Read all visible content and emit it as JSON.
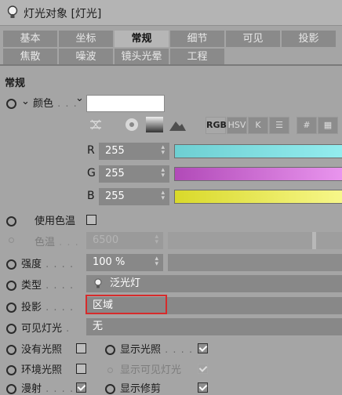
{
  "window": {
    "title": "灯光对象 [灯光]"
  },
  "tabs_row1": [
    "基本",
    "坐标",
    "常规",
    "细节",
    "可见",
    "投影"
  ],
  "tabs_row2": [
    "焦散",
    "噪波",
    "镜头光晕",
    "工程"
  ],
  "selected_tab": "常规",
  "section_title": "常规",
  "color": {
    "label": "颜色",
    "swatch": "#ffffff",
    "modes": [
      "RGB",
      "HSV",
      "K",
      "#"
    ],
    "r": {
      "label": "R",
      "value": "255"
    },
    "g": {
      "label": "G",
      "value": "255"
    },
    "b": {
      "label": "B",
      "value": "255"
    }
  },
  "use_temperature": {
    "label": "使用色温",
    "checked": false
  },
  "temperature": {
    "label": "色温",
    "value": "6500"
  },
  "intensity": {
    "label": "强度",
    "value": "100 %"
  },
  "type": {
    "label": "类型",
    "value": "泛光灯"
  },
  "shadow": {
    "label": "投影",
    "value": "区域",
    "highlight": "#d62b2b"
  },
  "visible_light": {
    "label": "可见灯光",
    "value": "无"
  },
  "no_illumination": {
    "label": "没有光照",
    "checked": false
  },
  "show_illumination": {
    "label": "显示光照",
    "checked": true
  },
  "ambient_illumination": {
    "label": "环境光照",
    "checked": false
  },
  "show_visible_light": {
    "label": "显示可见灯光",
    "checked": true
  },
  "diffuse": {
    "label": "漫射",
    "checked": true
  },
  "show_clipping": {
    "label": "显示修剪",
    "checked": true
  }
}
